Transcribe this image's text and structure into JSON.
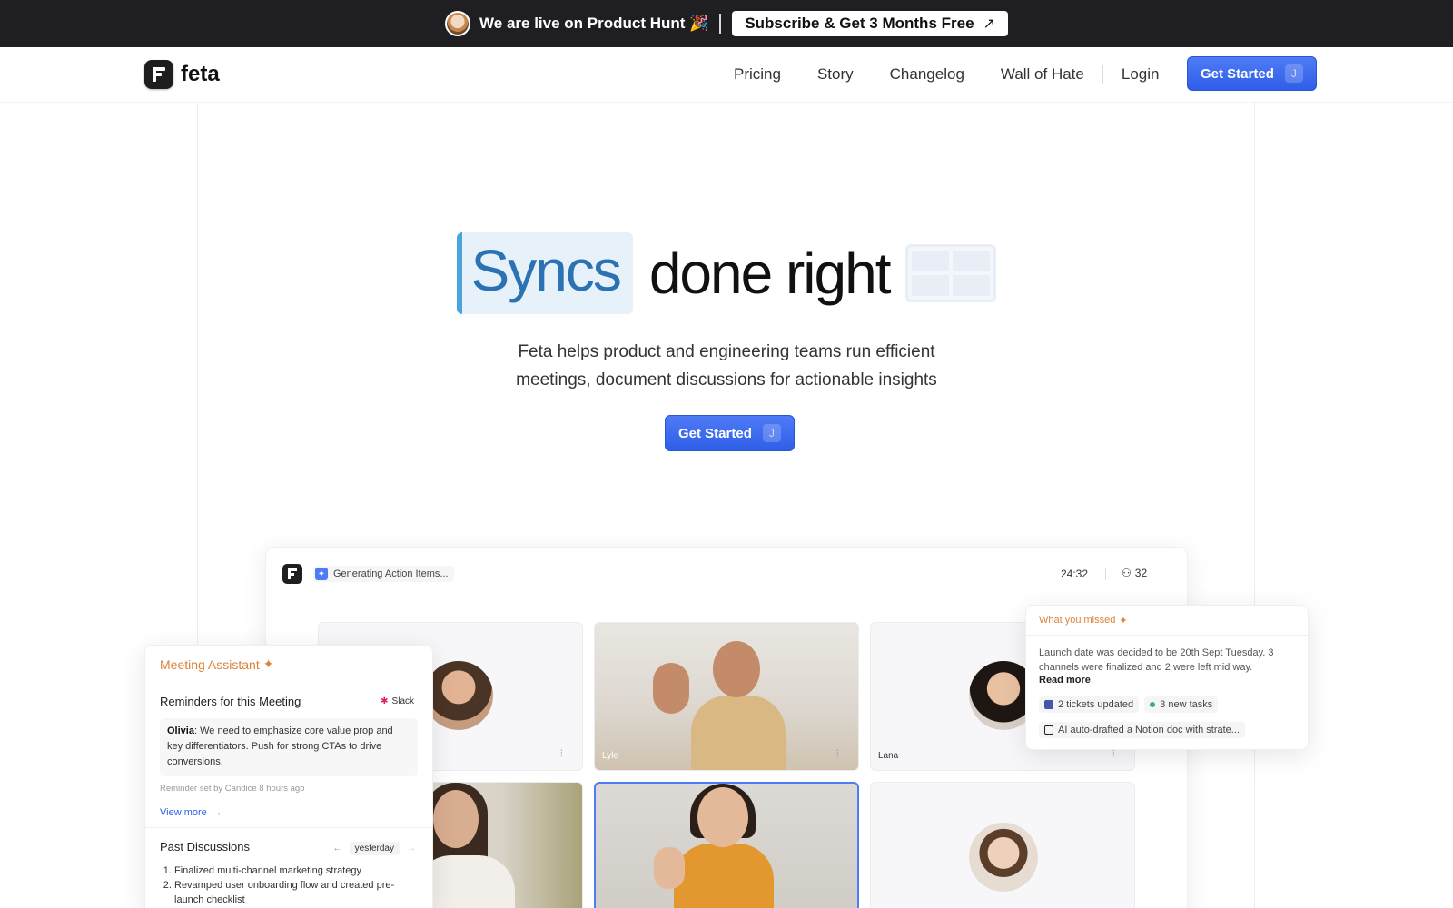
{
  "announcement": {
    "text": "We are live on Product Hunt 🎉",
    "cta": "Subscribe & Get 3 Months Free",
    "cta_icon": "arrow-up-right-icon"
  },
  "nav": {
    "brand": "feta",
    "links": [
      "Pricing",
      "Story",
      "Changelog",
      "Wall of Hate"
    ],
    "login": "Login",
    "cta": "Get Started",
    "cta_shortcut": "J"
  },
  "hero": {
    "highlight": "Syncs",
    "title_rest": "done right",
    "subtitle_line1": "Feta helps product and engineering teams run efficient",
    "subtitle_line2": "meetings, document discussions for actionable insights",
    "cta": "Get Started",
    "cta_shortcut": "J"
  },
  "app": {
    "status": "Generating Action Items...",
    "timer": "24:32",
    "participants": "32",
    "tiles": [
      {
        "name": ""
      },
      {
        "name": "Lyle"
      },
      {
        "name": "Lana"
      },
      {
        "name": ""
      },
      {
        "name": ""
      },
      {
        "name": ""
      }
    ]
  },
  "assistant": {
    "title": "Meeting Assistant",
    "reminders_heading": "Reminders for this Meeting",
    "source": "Slack",
    "note_author": "Olivia",
    "note_text": ": We need to emphasize core value prop and key differentiators. Push for strong CTAs to drive conversions.",
    "meta": "Reminder set by Candice 8 hours ago",
    "view_more": "View more",
    "past_heading": "Past Discussions",
    "past_period": "yesterday",
    "past_items": [
      "Finalized multi-channel marketing strategy",
      "Revamped user onboarding flow and created pre-launch checklist"
    ]
  },
  "missed": {
    "title": "What you missed",
    "body": "Launch date was decided to be 20th Sept Tuesday. 3 channels were finalized and 2 were left mid way.",
    "read_more": "Read more",
    "chip_tickets": "2 tickets updated",
    "chip_tasks": "3 new tasks",
    "chip_notion": "AI auto-drafted a Notion doc with strate..."
  },
  "colors": {
    "accent": "#2f5ee8",
    "highlight_bg": "#e7f1fa",
    "highlight_text": "#2a72b2",
    "assistant_title": "#d9833b",
    "topbar_bg": "#1f1f23"
  }
}
